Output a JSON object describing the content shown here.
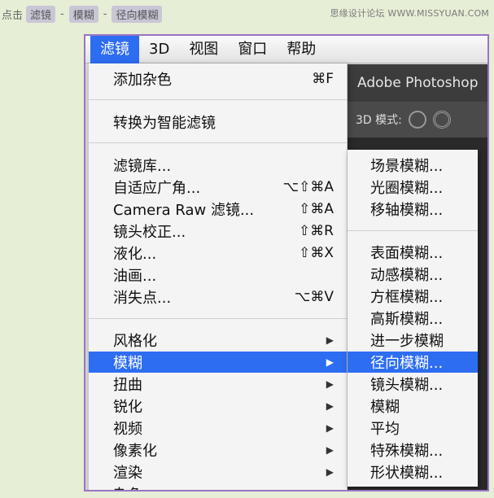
{
  "instruction": {
    "prefix": "点击",
    "step1": "滤镜",
    "sep1": "-",
    "step2": "模糊",
    "sep2": "-",
    "step3": "径向模糊"
  },
  "watermark": "思缘设计论坛 WWW.MISSYUAN.COM",
  "menubar": {
    "items": [
      "滤镜",
      "3D",
      "视图",
      "窗口",
      "帮助"
    ]
  },
  "app": {
    "title": "Adobe Photoshop",
    "mode_label": "3D 模式:"
  },
  "filter_menu": {
    "items": [
      {
        "label": "添加杂色",
        "shortcut": "⌘F"
      },
      {
        "label": "转换为智能滤镜",
        "shortcut": ""
      },
      {
        "label": "滤镜库...",
        "shortcut": ""
      },
      {
        "label": "自适应广角...",
        "shortcut": "⌥⇧⌘A"
      },
      {
        "label": "Camera Raw 滤镜...",
        "shortcut": "⇧⌘A"
      },
      {
        "label": "镜头校正...",
        "shortcut": "⇧⌘R"
      },
      {
        "label": "液化...",
        "shortcut": "⇧⌘X"
      },
      {
        "label": "油画...",
        "shortcut": ""
      },
      {
        "label": "消失点...",
        "shortcut": "⌥⌘V"
      },
      {
        "label": "风格化",
        "arrow": "▶"
      },
      {
        "label": "模糊",
        "arrow": "▶"
      },
      {
        "label": "扭曲",
        "arrow": "▶"
      },
      {
        "label": "锐化",
        "arrow": "▶"
      },
      {
        "label": "视频",
        "arrow": "▶"
      },
      {
        "label": "像素化",
        "arrow": "▶"
      },
      {
        "label": "渲染",
        "arrow": "▶"
      },
      {
        "label": "杂色",
        "arrow": "▶"
      }
    ]
  },
  "blur_submenu": {
    "items": [
      "场景模糊...",
      "光圈模糊...",
      "移轴模糊...",
      "表面模糊...",
      "动感模糊...",
      "方框模糊...",
      "高斯模糊...",
      "进一步模糊",
      "径向模糊...",
      "镜头模糊...",
      "模糊",
      "平均",
      "特殊模糊...",
      "形状模糊..."
    ]
  }
}
